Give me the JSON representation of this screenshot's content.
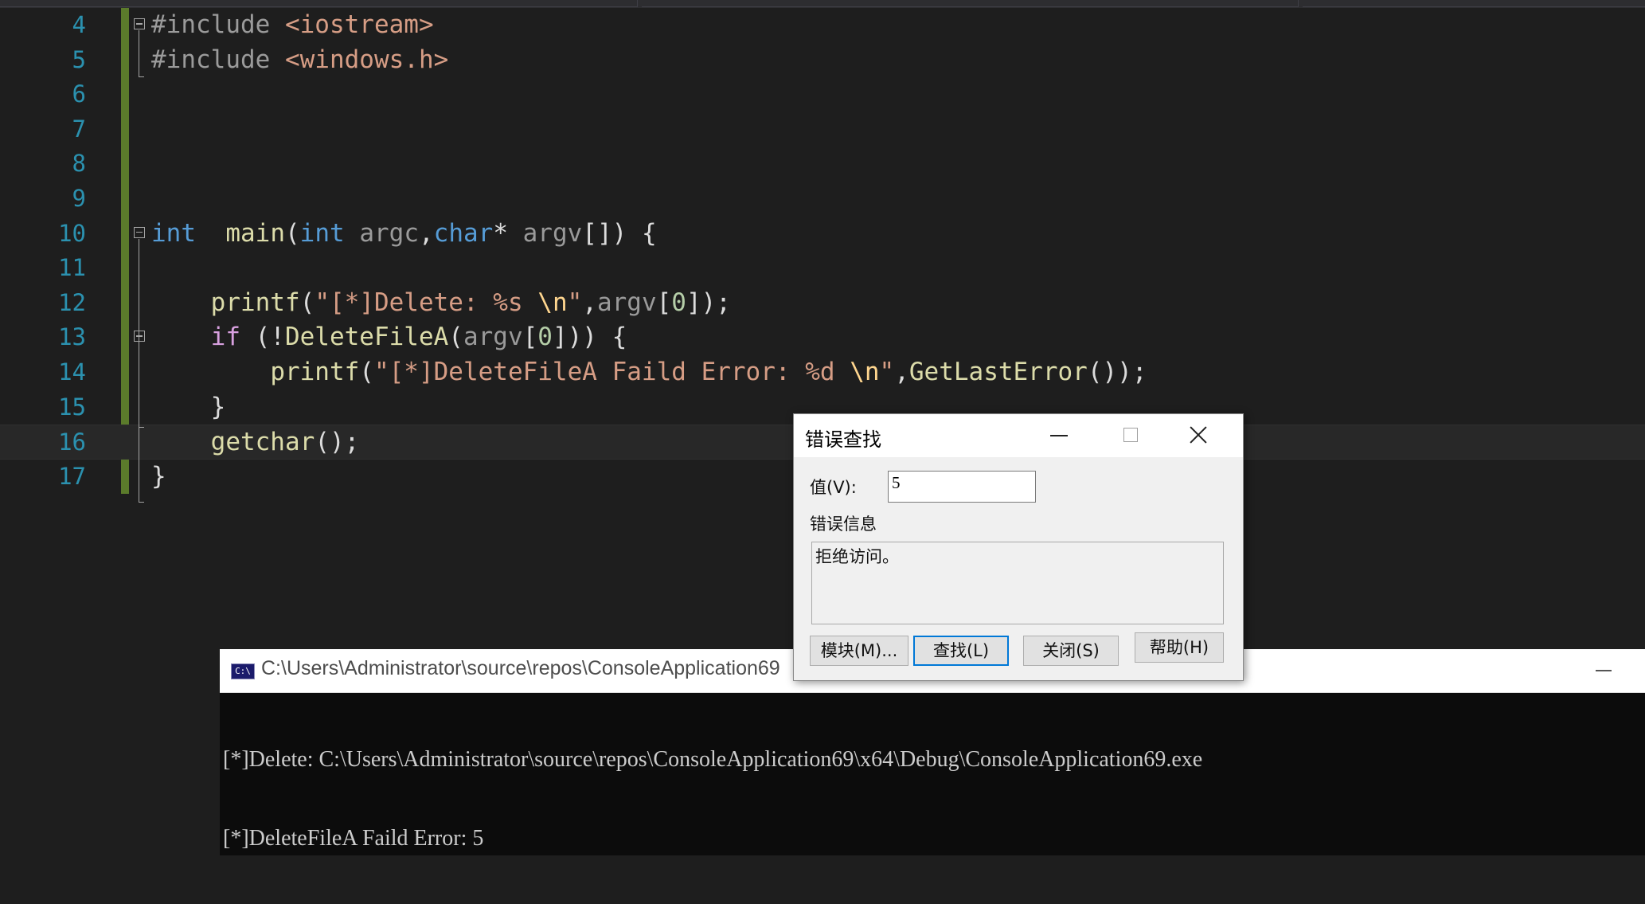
{
  "editor": {
    "lines": [
      {
        "num": "4",
        "fold": true,
        "tokens": [
          [
            "pp",
            "#include "
          ],
          [
            "inc",
            "<iostream>"
          ]
        ]
      },
      {
        "num": "5",
        "fold": false,
        "tokens": [
          [
            "pp",
            "#include "
          ],
          [
            "inc",
            "<windows.h>"
          ]
        ]
      },
      {
        "num": "6",
        "fold": false,
        "tokens": []
      },
      {
        "num": "7",
        "fold": false,
        "tokens": []
      },
      {
        "num": "8",
        "fold": false,
        "tokens": []
      },
      {
        "num": "9",
        "fold": false,
        "tokens": []
      },
      {
        "num": "10",
        "fold": true,
        "tokens": [
          [
            "kw",
            "int"
          ],
          [
            "",
            "  "
          ],
          [
            "fn",
            "main"
          ],
          [
            "",
            "("
          ],
          [
            "kw",
            "int"
          ],
          [
            "",
            " "
          ],
          [
            "par",
            "argc"
          ],
          [
            "",
            ","
          ],
          [
            "kw",
            "char"
          ],
          [
            "",
            "* "
          ],
          [
            "par",
            "argv"
          ],
          [
            "",
            "[]) {"
          ]
        ]
      },
      {
        "num": "11",
        "fold": false,
        "tokens": []
      },
      {
        "num": "12",
        "fold": false,
        "tokens": [
          [
            "",
            "    "
          ],
          [
            "fn",
            "printf"
          ],
          [
            "",
            "("
          ],
          [
            "str",
            "\"[*]Delete: %s "
          ],
          [
            "esc",
            "\\n"
          ],
          [
            "str",
            "\""
          ],
          [
            "",
            ","
          ],
          [
            "par",
            "argv"
          ],
          [
            "",
            "["
          ],
          [
            "num",
            "0"
          ],
          [
            "",
            "]);"
          ]
        ]
      },
      {
        "num": "13",
        "fold": true,
        "tokens": [
          [
            "",
            "    "
          ],
          [
            "ctl",
            "if"
          ],
          [
            "",
            " (!"
          ],
          [
            "fn",
            "DeleteFileA"
          ],
          [
            "",
            "("
          ],
          [
            "par",
            "argv"
          ],
          [
            "",
            "["
          ],
          [
            "num",
            "0"
          ],
          [
            "",
            "])) {"
          ]
        ]
      },
      {
        "num": "14",
        "fold": false,
        "tokens": [
          [
            "",
            "        "
          ],
          [
            "fn",
            "printf"
          ],
          [
            "",
            "("
          ],
          [
            "str",
            "\"[*]DeleteFileA Faild Error: %d "
          ],
          [
            "esc",
            "\\n"
          ],
          [
            "str",
            "\""
          ],
          [
            "",
            ","
          ],
          [
            "fn",
            "GetLastError"
          ],
          [
            "",
            "());"
          ]
        ]
      },
      {
        "num": "15",
        "fold": false,
        "tokens": [
          [
            "",
            "    }"
          ]
        ]
      },
      {
        "num": "16",
        "fold": false,
        "current": true,
        "tokens": [
          [
            "",
            "    "
          ],
          [
            "fn",
            "getchar"
          ],
          [
            "",
            "();"
          ]
        ]
      },
      {
        "num": "17",
        "fold": false,
        "tokens": [
          [
            "",
            "}"
          ]
        ]
      }
    ]
  },
  "console": {
    "title": "C:\\Users\\Administrator\\source\\repos\\ConsoleApplication69",
    "icon_text": "C:\\",
    "output_lines": [
      "[*]Delete: C:\\Users\\Administrator\\source\\repos\\ConsoleApplication69\\x64\\Debug\\ConsoleApplication69.exe",
      "[*]DeleteFileA Faild Error: 5"
    ]
  },
  "dialog": {
    "title": "错误查找",
    "value_label": "值(V):",
    "value": "5",
    "message_label": "错误信息",
    "message": "拒绝访问。",
    "buttons": {
      "modules": "模块(M)...",
      "find": "查找(L)",
      "close": "关闭(S)",
      "help": "帮助(H)"
    }
  }
}
